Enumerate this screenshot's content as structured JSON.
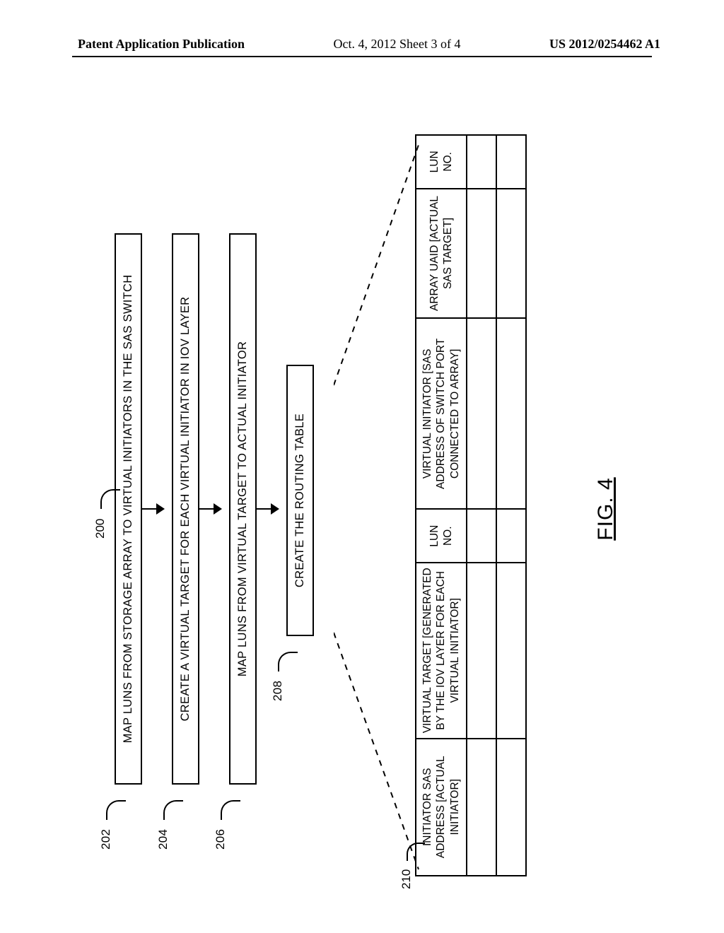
{
  "header": {
    "left": "Patent Application Publication",
    "center": "Oct. 4, 2012  Sheet 3 of 4",
    "right": "US 2012/0254462 A1"
  },
  "figure": {
    "caption": "FIG. 4",
    "overall_ref": "200",
    "table_ref": "210",
    "steps": [
      {
        "ref": "202",
        "text": "MAP LUNS FROM STORAGE ARRAY TO VIRTUAL INITIATORS IN THE SAS SWITCH"
      },
      {
        "ref": "204",
        "text": "CREATE A VIRTUAL TARGET FOR EACH VIRTUAL INITIATOR IN IOV LAYER"
      },
      {
        "ref": "206",
        "text": "MAP LUNS FROM VIRTUAL TARGET TO ACTUAL INITIATOR"
      },
      {
        "ref": "208",
        "text": "CREATE THE ROUTING TABLE"
      }
    ],
    "table": {
      "columns": [
        "INITIATOR SAS ADDRESS [ACTUAL INITIATOR]",
        "VIRTUAL TARGET [GENERATED BY THE IOV LAYER FOR EACH VIRTUAL INITIATOR]",
        "LUN NO.",
        "VIRTUAL INITIATOR [SAS ADDRESS OF SWITCH PORT CONNECTED TO ARRAY]",
        "ARRAY UAID [ACTUAL SAS TARGET]",
        "LUN NO."
      ],
      "rows": [
        [
          "",
          "",
          "",
          "",
          "",
          ""
        ],
        [
          "",
          "",
          "",
          "",
          "",
          ""
        ]
      ]
    }
  }
}
